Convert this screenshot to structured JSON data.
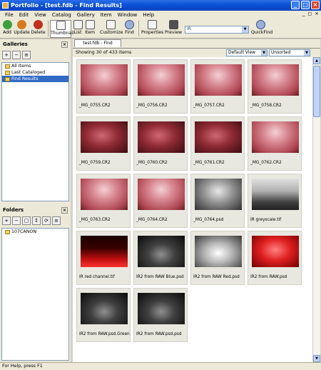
{
  "window": {
    "title": "Portfolio - [test.fdb - Find Results]"
  },
  "menu": {
    "items": [
      "File",
      "Edit",
      "View",
      "Catalog",
      "Gallery",
      "Item",
      "Window",
      "Help"
    ]
  },
  "toolbar": {
    "add": "Add",
    "update": "Update",
    "delete": "Delete",
    "thumbnail": "Thumbnail",
    "list": "List",
    "item": "Item",
    "customize": "Customize",
    "find": "Find",
    "properties": "Properties",
    "preview": "Preview",
    "quickfind": "QuickFind",
    "search_value": "IR"
  },
  "galleries": {
    "header": "Galleries",
    "items": [
      "All Items",
      "Last Cataloged",
      "Find Results"
    ],
    "selected": "Find Results"
  },
  "folders": {
    "header": "Folders",
    "items": [
      "107CANON"
    ]
  },
  "main": {
    "tab": "test.fdb - Find Results",
    "count": "Showing 30 of 433 items",
    "view_option": "Default View",
    "sort_option": "Unsorted",
    "items": [
      {
        "name": "_MG_0755.CR2",
        "kind": "red"
      },
      {
        "name": "_MG_0756.CR2",
        "kind": "red"
      },
      {
        "name": "_MG_0757.CR2",
        "kind": "red"
      },
      {
        "name": "_MG_0758.CR2",
        "kind": "red"
      },
      {
        "name": "_MG_0759.CR2",
        "kind": "darkred"
      },
      {
        "name": "_MG_0760.CR2",
        "kind": "darkred"
      },
      {
        "name": "_MG_0761.CR2",
        "kind": "darkred"
      },
      {
        "name": "_MG_0762.CR2",
        "kind": "red"
      },
      {
        "name": "_MG_0763.CR2",
        "kind": "red"
      },
      {
        "name": "_MG_0764.CR2",
        "kind": "red"
      },
      {
        "name": "_MG_0764.psd",
        "kind": "gray"
      },
      {
        "name": "IR greyscale.tif",
        "kind": "graycity"
      },
      {
        "name": "IR red channel.tif",
        "kind": "redcity"
      },
      {
        "name": "IR2 from RAW Blue.psd",
        "kind": "darkgray"
      },
      {
        "name": "IR2 from RAW Red.psd",
        "kind": "lightgray"
      },
      {
        "name": "IR2 from RAW.psd",
        "kind": "brightred"
      },
      {
        "name": "IR2 from RAW.psd.Green",
        "kind": "darkgray"
      },
      {
        "name": "IR2 from RAW.psd.psd",
        "kind": "darkgray"
      }
    ]
  },
  "status": {
    "text": "For Help, press F1"
  },
  "colors": {
    "title_bar": "#0a4fd4",
    "selection": "#316ac5",
    "panel": "#ece9d8"
  }
}
